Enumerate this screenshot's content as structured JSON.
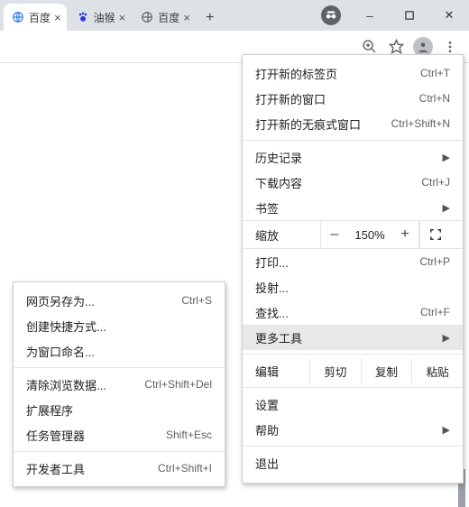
{
  "tabs": [
    {
      "title": "百度",
      "icon": "globe-blue"
    },
    {
      "title": "油猴",
      "icon": "baidu-paw"
    },
    {
      "title": "百度",
      "icon": "globe-grey"
    }
  ],
  "window": {
    "minimize": "–",
    "maximize": "□",
    "close": "✕"
  },
  "menu": {
    "new_tab": {
      "label": "打开新的标签页",
      "shortcut": "Ctrl+T"
    },
    "new_window": {
      "label": "打开新的窗口",
      "shortcut": "Ctrl+N"
    },
    "new_incognito": {
      "label": "打开新的无痕式窗口",
      "shortcut": "Ctrl+Shift+N"
    },
    "history": {
      "label": "历史记录"
    },
    "downloads": {
      "label": "下载内容",
      "shortcut": "Ctrl+J"
    },
    "bookmarks": {
      "label": "书签"
    },
    "zoom": {
      "label": "缩放",
      "minus": "–",
      "value": "150%",
      "plus": "+"
    },
    "print": {
      "label": "打印...",
      "shortcut": "Ctrl+P"
    },
    "cast": {
      "label": "投射..."
    },
    "find": {
      "label": "查找...",
      "shortcut": "Ctrl+F"
    },
    "more_tools": {
      "label": "更多工具"
    },
    "edit": {
      "label": "编辑",
      "cut": "剪切",
      "copy": "复制",
      "paste": "粘贴"
    },
    "settings": {
      "label": "设置"
    },
    "help": {
      "label": "帮助"
    },
    "exit": {
      "label": "退出"
    }
  },
  "submenu": {
    "save_as": {
      "label": "网页另存为...",
      "shortcut": "Ctrl+S"
    },
    "create_shortcut": {
      "label": "创建快捷方式..."
    },
    "name_window": {
      "label": "为窗口命名..."
    },
    "clear_data": {
      "label": "清除浏览数据...",
      "shortcut": "Ctrl+Shift+Del"
    },
    "extensions": {
      "label": "扩展程序"
    },
    "task_manager": {
      "label": "任务管理器",
      "shortcut": "Shift+Esc"
    },
    "dev_tools": {
      "label": "开发者工具",
      "shortcut": "Ctrl+Shift+I"
    }
  }
}
